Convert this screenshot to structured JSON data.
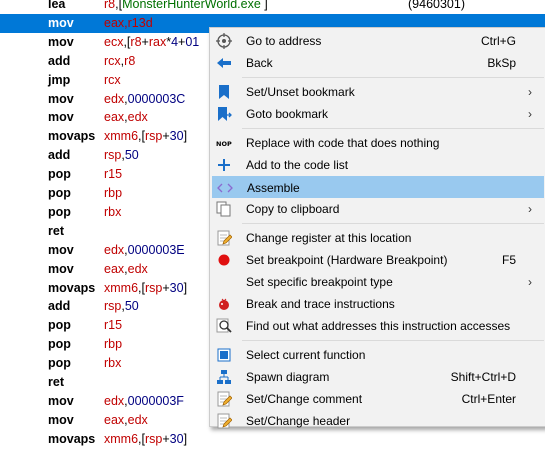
{
  "listing": {
    "rows": [
      {
        "mnemonic": "lea",
        "operands": [
          [
            "reg",
            "r8"
          ],
          [
            "pun",
            ",["
          ],
          [
            "sym",
            "MonsterHunterWorld.exe"
          ],
          [
            "pun",
            " ]"
          ]
        ],
        "comment": "(9460301)"
      },
      {
        "mnemonic": "mov",
        "operands": [
          [
            "reg",
            "eax,r13d"
          ]
        ],
        "selected": true
      },
      {
        "mnemonic": "mov",
        "operands": [
          [
            "reg",
            "ecx"
          ],
          [
            "pun",
            ",["
          ],
          [
            "reg",
            "r8"
          ],
          [
            "pun",
            "+"
          ],
          [
            "reg",
            "rax"
          ],
          [
            "pun",
            "*"
          ],
          [
            "num",
            "4"
          ],
          [
            "pun",
            "+"
          ],
          [
            "num",
            "01"
          ]
        ]
      },
      {
        "mnemonic": "add",
        "operands": [
          [
            "reg",
            "rcx"
          ],
          [
            "pun",
            ","
          ],
          [
            "reg",
            "r8"
          ]
        ]
      },
      {
        "mnemonic": "jmp",
        "operands": [
          [
            "reg",
            "rcx"
          ]
        ]
      },
      {
        "mnemonic": "mov",
        "operands": [
          [
            "reg",
            "edx"
          ],
          [
            "pun",
            ","
          ],
          [
            "num",
            "0000003C"
          ]
        ]
      },
      {
        "mnemonic": "mov",
        "operands": [
          [
            "reg",
            "eax"
          ],
          [
            "pun",
            ","
          ],
          [
            "reg",
            "edx"
          ]
        ]
      },
      {
        "mnemonic": "movaps",
        "operands": [
          [
            "reg",
            "xmm6"
          ],
          [
            "pun",
            ",["
          ],
          [
            "reg",
            "rsp"
          ],
          [
            "pun",
            "+"
          ],
          [
            "num",
            "30"
          ],
          [
            "pun",
            "]"
          ]
        ]
      },
      {
        "mnemonic": "add",
        "operands": [
          [
            "reg",
            "rsp"
          ],
          [
            "pun",
            ","
          ],
          [
            "num",
            "50"
          ]
        ]
      },
      {
        "mnemonic": "pop",
        "operands": [
          [
            "reg",
            "r15"
          ]
        ]
      },
      {
        "mnemonic": "pop",
        "operands": [
          [
            "reg",
            "rbp"
          ]
        ]
      },
      {
        "mnemonic": "pop",
        "operands": [
          [
            "reg",
            "rbx"
          ]
        ]
      },
      {
        "mnemonic": "ret",
        "operands": []
      },
      {
        "mnemonic": "mov",
        "operands": [
          [
            "reg",
            "edx"
          ],
          [
            "pun",
            ","
          ],
          [
            "num",
            "0000003E"
          ]
        ]
      },
      {
        "mnemonic": "mov",
        "operands": [
          [
            "reg",
            "eax"
          ],
          [
            "pun",
            ","
          ],
          [
            "reg",
            "edx"
          ]
        ]
      },
      {
        "mnemonic": "movaps",
        "operands": [
          [
            "reg",
            "xmm6"
          ],
          [
            "pun",
            ",["
          ],
          [
            "reg",
            "rsp"
          ],
          [
            "pun",
            "+"
          ],
          [
            "num",
            "30"
          ],
          [
            "pun",
            "]"
          ]
        ]
      },
      {
        "mnemonic": "add",
        "operands": [
          [
            "reg",
            "rsp"
          ],
          [
            "pun",
            ","
          ],
          [
            "num",
            "50"
          ]
        ]
      },
      {
        "mnemonic": "pop",
        "operands": [
          [
            "reg",
            "r15"
          ]
        ]
      },
      {
        "mnemonic": "pop",
        "operands": [
          [
            "reg",
            "rbp"
          ]
        ]
      },
      {
        "mnemonic": "pop",
        "operands": [
          [
            "reg",
            "rbx"
          ]
        ]
      },
      {
        "mnemonic": "ret",
        "operands": []
      },
      {
        "mnemonic": "mov",
        "operands": [
          [
            "reg",
            "edx"
          ],
          [
            "pun",
            ","
          ],
          [
            "num",
            "0000003F"
          ]
        ]
      },
      {
        "mnemonic": "mov",
        "operands": [
          [
            "reg",
            "eax"
          ],
          [
            "pun",
            ","
          ],
          [
            "reg",
            "edx"
          ]
        ]
      },
      {
        "mnemonic": "movaps",
        "operands": [
          [
            "reg",
            "xmm6"
          ],
          [
            "pun",
            ",["
          ],
          [
            "reg",
            "rsp"
          ],
          [
            "pun",
            "+"
          ],
          [
            "num",
            "30"
          ],
          [
            "pun",
            "]"
          ]
        ]
      }
    ]
  },
  "context_menu": {
    "items": [
      {
        "icon": "target-icon",
        "label": "Go to address",
        "shortcut": "Ctrl+G"
      },
      {
        "icon": "back-arrow-icon",
        "label": "Back",
        "shortcut": "BkSp"
      },
      {
        "separator": true
      },
      {
        "icon": "bookmark-icon",
        "label": "Set/Unset bookmark",
        "submenu": true
      },
      {
        "icon": "goto-bookmark-icon",
        "label": "Goto bookmark",
        "submenu": true
      },
      {
        "separator": true
      },
      {
        "icon": "nop-icon",
        "icon_text": "NOP",
        "label": "Replace with code that does nothing"
      },
      {
        "icon": "plus-icon",
        "label": "Add to the code list"
      },
      {
        "icon": "assemble-icon",
        "label": "Assemble",
        "highlighted": true
      },
      {
        "icon": "copy-icon",
        "label": "Copy to clipboard",
        "submenu": true
      },
      {
        "separator": true
      },
      {
        "icon": "edit-register-icon",
        "label": "Change register at this location"
      },
      {
        "icon": "breakpoint-icon",
        "label": "Set breakpoint (Hardware Breakpoint)",
        "shortcut": "F5"
      },
      {
        "icon": "",
        "label": "Set specific breakpoint type",
        "submenu": true
      },
      {
        "icon": "break-trace-icon",
        "label": "Break and trace instructions"
      },
      {
        "icon": "find-icon",
        "label": "Find out what addresses this instruction accesses"
      },
      {
        "separator": true
      },
      {
        "icon": "select-function-icon",
        "label": "Select current function"
      },
      {
        "icon": "diagram-icon",
        "label": "Spawn diagram",
        "shortcut": "Shift+Ctrl+D"
      },
      {
        "icon": "comment-icon",
        "label": "Set/Change comment",
        "shortcut": "Ctrl+Enter"
      },
      {
        "icon": "header-icon",
        "label": "Set/Change header"
      }
    ]
  },
  "colors": {
    "selection": "#0078d7",
    "highlight": "#99c9ef",
    "register": "#c00000",
    "number": "#000080",
    "symbol": "#007000"
  }
}
